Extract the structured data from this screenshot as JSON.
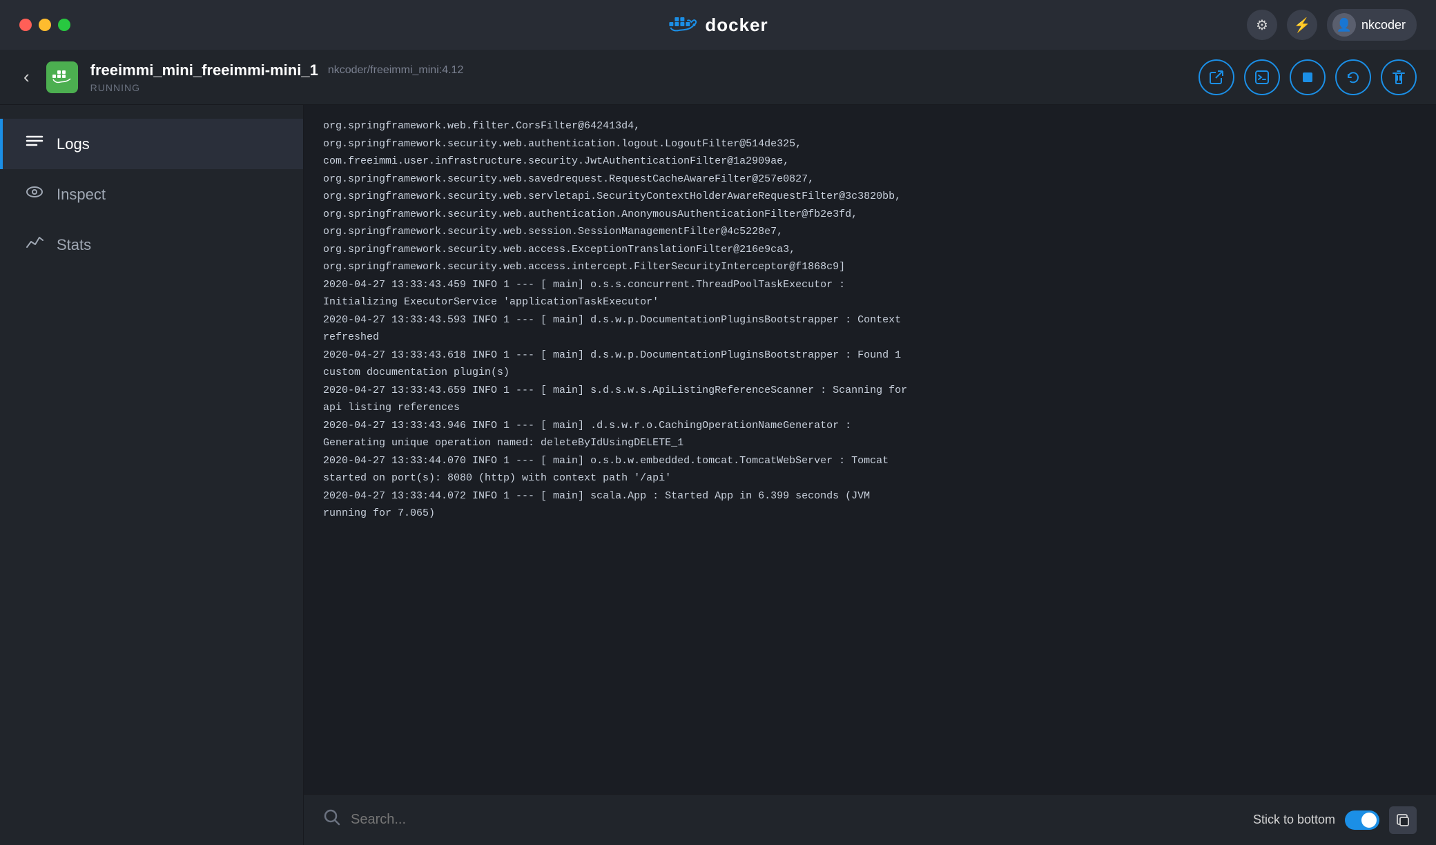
{
  "titlebar": {
    "dots": [
      {
        "color": "dot-red",
        "label": "close"
      },
      {
        "color": "dot-yellow",
        "label": "minimize"
      },
      {
        "color": "dot-green",
        "label": "maximize"
      }
    ],
    "app_name": "docker",
    "right_buttons": [
      {
        "name": "settings-button",
        "icon": "⚙",
        "label": "Settings"
      },
      {
        "name": "extensions-button",
        "icon": "⚡",
        "label": "Extensions"
      }
    ],
    "user": {
      "name": "nkcoder",
      "avatar_icon": "👤"
    }
  },
  "container_header": {
    "container_name": "freeimmi_mini_freeimmi-mini_1",
    "container_image": "nkcoder/freeimmi_mini:4.12",
    "container_status": "RUNNING",
    "back_label": "‹",
    "action_buttons": [
      {
        "name": "open-browser-button",
        "icon": "↗",
        "label": "Open in browser"
      },
      {
        "name": "terminal-button",
        "icon": ">_",
        "label": "Open terminal"
      },
      {
        "name": "stop-button",
        "icon": "■",
        "label": "Stop"
      },
      {
        "name": "restart-button",
        "icon": "↺",
        "label": "Restart"
      },
      {
        "name": "delete-button",
        "icon": "🗑",
        "label": "Delete"
      }
    ]
  },
  "sidebar": {
    "items": [
      {
        "name": "logs",
        "label": "Logs",
        "icon": "≡",
        "active": true
      },
      {
        "name": "inspect",
        "label": "Inspect",
        "icon": "👁",
        "active": false
      },
      {
        "name": "stats",
        "label": "Stats",
        "icon": "📈",
        "active": false
      }
    ]
  },
  "logs": {
    "lines": [
      "org.springframework.web.filter.CorsFilter@642413d4,",
      "org.springframework.security.web.authentication.logout.LogoutFilter@514de325,",
      "com.freeimmi.user.infrastructure.security.JwtAuthenticationFilter@1a2909ae,",
      "org.springframework.security.web.savedrequest.RequestCacheAwareFilter@257e0827,",
      "org.springframework.security.web.servletapi.SecurityContextHolderAwareRequestFilter@3c3820bb,",
      "org.springframework.security.web.authentication.AnonymousAuthenticationFilter@fb2e3fd,",
      "org.springframework.security.web.session.SessionManagementFilter@4c5228e7,",
      "org.springframework.security.web.access.ExceptionTranslationFilter@216e9ca3,",
      "org.springframework.security.web.access.intercept.FilterSecurityInterceptor@f1868c9]",
      "2020-04-27 13:33:43.459 INFO 1 --- [ main] o.s.s.concurrent.ThreadPoolTaskExecutor :",
      "Initializing ExecutorService 'applicationTaskExecutor'",
      "2020-04-27 13:33:43.593 INFO 1 --- [ main] d.s.w.p.DocumentationPluginsBootstrapper : Context",
      "refreshed",
      "2020-04-27 13:33:43.618 INFO 1 --- [ main] d.s.w.p.DocumentationPluginsBootstrapper : Found 1",
      "custom documentation plugin(s)",
      "2020-04-27 13:33:43.659 INFO 1 --- [ main] s.d.s.w.s.ApiListingReferenceScanner : Scanning for",
      "api listing references",
      "2020-04-27 13:33:43.946 INFO 1 --- [ main] .d.s.w.r.o.CachingOperationNameGenerator :",
      "Generating unique operation named: deleteByIdUsingDELETE_1",
      "2020-04-27 13:33:44.070 INFO 1 --- [ main] o.s.b.w.embedded.tomcat.TomcatWebServer : Tomcat",
      "started on port(s): 8080 (http) with context path '/api'",
      "2020-04-27 13:33:44.072 INFO 1 --- [ main] scala.App : Started App in 6.399 seconds (JVM",
      "running for 7.065)"
    ]
  },
  "search": {
    "placeholder": "Search...",
    "stick_to_bottom_label": "Stick to bottom"
  }
}
